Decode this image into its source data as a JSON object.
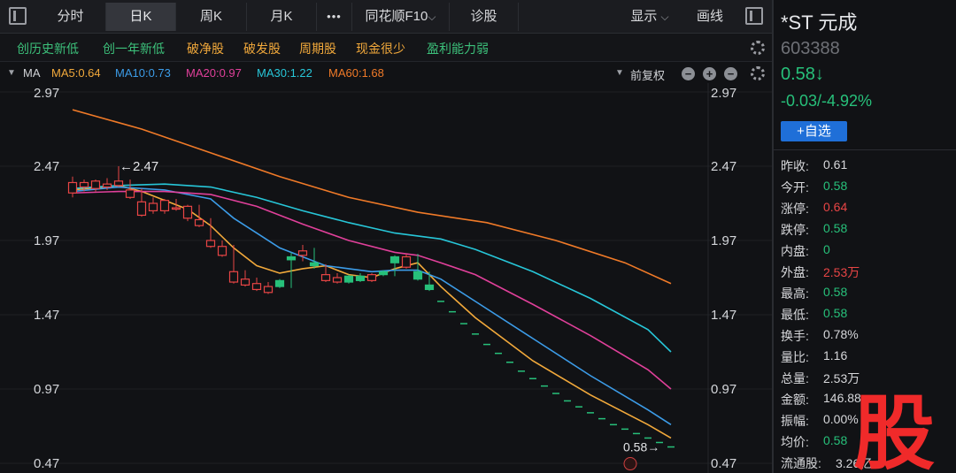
{
  "tabs": {
    "fenshi": "分时",
    "rik": "日K",
    "zhouk": "周K",
    "yuek": "月K",
    "more": "•••",
    "f10": "同花顺F10",
    "zhengu": "诊股",
    "xianshi": "显示",
    "huaxian": "画线"
  },
  "filters": [
    "创历史新低",
    "创一年新低",
    "破净股",
    "破发股",
    "周期股",
    "现金很少",
    "盈利能力弱"
  ],
  "ma": {
    "label": "MA",
    "ma5": "MA5:0.64",
    "ma10": "MA10:0.73",
    "ma20": "MA20:0.97",
    "ma30": "MA30:1.22",
    "ma60": "MA60:1.68",
    "adjust": "前复权"
  },
  "colors": {
    "up": "#e84545",
    "down": "#27c07a",
    "ma5": "#f2a93b",
    "ma10": "#3c9ce8",
    "ma20": "#e0409a",
    "ma30": "#27c6d8",
    "ma60": "#f07a28",
    "filterGreen": "#3cc07a",
    "filterOrange": "#f2a93b"
  },
  "chart_data": {
    "type": "candlestick",
    "ylim": [
      0.47,
      2.97
    ],
    "yticks": [
      "2.97",
      "2.47",
      "1.97",
      "1.47",
      "0.97",
      "0.47"
    ],
    "high_label": "←2.47",
    "low_label": "0.58→",
    "candles": [
      [
        2.33,
        2.36,
        2.29,
        2.4,
        2.26
      ],
      [
        2.36,
        2.36,
        2.33,
        2.38,
        2.3
      ],
      [
        2.33,
        2.37,
        2.32,
        2.38,
        2.3
      ],
      [
        2.37,
        2.35,
        2.33,
        2.39,
        2.31
      ],
      [
        2.35,
        2.37,
        2.34,
        2.47,
        2.33
      ],
      [
        2.37,
        2.31,
        2.26,
        2.38,
        2.25
      ],
      [
        2.31,
        2.23,
        2.14,
        2.32,
        2.13
      ],
      [
        2.23,
        2.22,
        2.17,
        2.26,
        2.15
      ],
      [
        2.22,
        2.24,
        2.17,
        2.25,
        2.15
      ],
      [
        2.24,
        2.19,
        2.19,
        2.25,
        2.17
      ],
      [
        2.19,
        2.2,
        2.12,
        2.21,
        2.1
      ],
      [
        2.2,
        2.11,
        2.07,
        2.21,
        2.06
      ],
      [
        2.11,
        1.97,
        1.93,
        2.12,
        1.92
      ],
      [
        1.97,
        1.93,
        1.87,
        1.97,
        1.86
      ],
      [
        1.93,
        1.76,
        1.69,
        1.94,
        1.68
      ],
      [
        1.76,
        1.71,
        1.67,
        1.77,
        1.66
      ],
      [
        1.71,
        1.68,
        1.64,
        1.72,
        1.63
      ],
      [
        1.68,
        1.66,
        1.62,
        1.69,
        1.61
      ],
      [
        1.66,
        1.66,
        1.7,
        1.71,
        1.65
      ],
      [
        1.66,
        1.84,
        1.86,
        1.89,
        1.65
      ],
      [
        1.84,
        1.9,
        1.87,
        1.94,
        1.83
      ],
      [
        1.9,
        1.8,
        1.82,
        1.92,
        1.78
      ],
      [
        1.8,
        1.74,
        1.7,
        1.81,
        1.69
      ],
      [
        1.74,
        1.72,
        1.69,
        1.75,
        1.68
      ],
      [
        1.72,
        1.69,
        1.73,
        1.74,
        1.68
      ],
      [
        1.69,
        1.7,
        1.73,
        1.75,
        1.69
      ],
      [
        1.7,
        1.74,
        1.7,
        1.75,
        1.69
      ],
      [
        1.74,
        1.74,
        1.76,
        1.77,
        1.73
      ],
      [
        1.74,
        1.82,
        1.86,
        1.87,
        1.73
      ],
      [
        1.82,
        1.86,
        1.79,
        1.88,
        1.78
      ],
      [
        1.86,
        1.71,
        1.76,
        1.88,
        1.7
      ],
      [
        1.71,
        1.64,
        1.67,
        1.76,
        1.63
      ],
      [
        1.64,
        1.56,
        1.56,
        1.56,
        1.56
      ],
      [
        1.56,
        1.49,
        1.49,
        1.49,
        1.49
      ],
      [
        1.49,
        1.41,
        1.41,
        1.41,
        1.41
      ],
      [
        1.41,
        1.34,
        1.34,
        1.34,
        1.34
      ],
      [
        1.34,
        1.27,
        1.27,
        1.27,
        1.27
      ],
      [
        1.27,
        1.21,
        1.21,
        1.21,
        1.21
      ],
      [
        1.21,
        1.15,
        1.15,
        1.15,
        1.15
      ],
      [
        1.15,
        1.09,
        1.09,
        1.09,
        1.09
      ],
      [
        1.09,
        1.04,
        1.04,
        1.04,
        1.04
      ],
      [
        1.04,
        0.99,
        0.99,
        0.99,
        0.99
      ],
      [
        0.99,
        0.94,
        0.94,
        0.94,
        0.94
      ],
      [
        0.94,
        0.89,
        0.89,
        0.89,
        0.89
      ],
      [
        0.89,
        0.85,
        0.85,
        0.85,
        0.85
      ],
      [
        0.85,
        0.81,
        0.81,
        0.81,
        0.81
      ],
      [
        0.81,
        0.77,
        0.77,
        0.77,
        0.77
      ],
      [
        0.77,
        0.73,
        0.73,
        0.73,
        0.73
      ],
      [
        0.73,
        0.7,
        0.7,
        0.7,
        0.7
      ],
      [
        0.7,
        0.67,
        0.67,
        0.67,
        0.67
      ],
      [
        0.67,
        0.64,
        0.64,
        0.64,
        0.64
      ],
      [
        0.64,
        0.61,
        0.61,
        0.61,
        0.61
      ],
      [
        0.61,
        0.58,
        0.58,
        0.58,
        0.58
      ]
    ],
    "candle_fields": [
      "prev_close",
      "close",
      "open",
      "high",
      "low"
    ],
    "series": [
      {
        "name": "MA5",
        "color": "#f2a93b",
        "values": [
          [
            0,
            2.31
          ],
          [
            4,
            2.34
          ],
          [
            6,
            2.3
          ],
          [
            8,
            2.24
          ],
          [
            10,
            2.18
          ],
          [
            12,
            2.07
          ],
          [
            14,
            1.92
          ],
          [
            16,
            1.8
          ],
          [
            18,
            1.75
          ],
          [
            20,
            1.78
          ],
          [
            22,
            1.8
          ],
          [
            24,
            1.74
          ],
          [
            26,
            1.72
          ],
          [
            28,
            1.78
          ],
          [
            30,
            1.82
          ],
          [
            32,
            1.66
          ],
          [
            35,
            1.45
          ],
          [
            40,
            1.16
          ],
          [
            45,
            0.93
          ],
          [
            50,
            0.73
          ],
          [
            52,
            0.64
          ]
        ]
      },
      {
        "name": "MA10",
        "color": "#3c9ce8",
        "values": [
          [
            0,
            2.3
          ],
          [
            4,
            2.33
          ],
          [
            8,
            2.31
          ],
          [
            12,
            2.25
          ],
          [
            14,
            2.12
          ],
          [
            16,
            2.02
          ],
          [
            18,
            1.92
          ],
          [
            20,
            1.86
          ],
          [
            22,
            1.8
          ],
          [
            24,
            1.78
          ],
          [
            26,
            1.76
          ],
          [
            28,
            1.77
          ],
          [
            30,
            1.77
          ],
          [
            32,
            1.71
          ],
          [
            35,
            1.56
          ],
          [
            40,
            1.31
          ],
          [
            45,
            1.06
          ],
          [
            50,
            0.83
          ],
          [
            52,
            0.73
          ]
        ]
      },
      {
        "name": "MA20",
        "color": "#e0409a",
        "values": [
          [
            0,
            2.29
          ],
          [
            4,
            2.3
          ],
          [
            8,
            2.3
          ],
          [
            12,
            2.28
          ],
          [
            16,
            2.2
          ],
          [
            20,
            2.08
          ],
          [
            24,
            1.97
          ],
          [
            28,
            1.89
          ],
          [
            30,
            1.87
          ],
          [
            32,
            1.82
          ],
          [
            35,
            1.74
          ],
          [
            40,
            1.54
          ],
          [
            45,
            1.33
          ],
          [
            50,
            1.1
          ],
          [
            52,
            0.97
          ]
        ]
      },
      {
        "name": "MA30",
        "color": "#27c6d8",
        "values": [
          [
            0,
            2.32
          ],
          [
            4,
            2.34
          ],
          [
            8,
            2.35
          ],
          [
            12,
            2.33
          ],
          [
            16,
            2.26
          ],
          [
            20,
            2.17
          ],
          [
            24,
            2.09
          ],
          [
            28,
            2.02
          ],
          [
            32,
            1.98
          ],
          [
            35,
            1.91
          ],
          [
            40,
            1.76
          ],
          [
            45,
            1.58
          ],
          [
            50,
            1.37
          ],
          [
            52,
            1.22
          ]
        ]
      },
      {
        "name": "MA60",
        "color": "#f07a28",
        "values": [
          [
            0,
            2.85
          ],
          [
            6,
            2.72
          ],
          [
            12,
            2.56
          ],
          [
            18,
            2.4
          ],
          [
            24,
            2.26
          ],
          [
            30,
            2.16
          ],
          [
            36,
            2.09
          ],
          [
            42,
            1.97
          ],
          [
            48,
            1.82
          ],
          [
            52,
            1.68
          ]
        ]
      }
    ]
  },
  "right": {
    "name": "*ST 元成",
    "code": "603388",
    "price": "0.58↓",
    "change": "-0.03/-4.92%",
    "add_button": "+自选",
    "quotes": [
      {
        "k": "昨收:",
        "v": "0.61",
        "c": "#d6d7da"
      },
      {
        "k": "今开:",
        "v": "0.58",
        "c": "#27c07a"
      },
      {
        "k": "涨停:",
        "v": "0.64",
        "c": "#e84545"
      },
      {
        "k": "跌停:",
        "v": "0.58",
        "c": "#27c07a"
      },
      {
        "k": "内盘:",
        "v": "0",
        "c": "#27c07a"
      },
      {
        "k": "外盘:",
        "v": "2.53万",
        "c": "#e84545"
      },
      {
        "k": "最高:",
        "v": "0.58",
        "c": "#27c07a"
      },
      {
        "k": "最低:",
        "v": "0.58",
        "c": "#27c07a"
      },
      {
        "k": "换手:",
        "v": "0.78%",
        "c": "#d6d7da"
      },
      {
        "k": "量比:",
        "v": "1.16",
        "c": "#d6d7da"
      },
      {
        "k": "总量:",
        "v": "2.53万",
        "c": "#d6d7da"
      },
      {
        "k": "金额:",
        "v": "146.88",
        "c": "#d6d7da"
      },
      {
        "k": "振幅:",
        "v": "0.00%",
        "c": "#d6d7da"
      },
      {
        "k": "均价:",
        "v": "0.58",
        "c": "#27c07a"
      },
      {
        "k": "流通股:",
        "v": "3.26亿",
        "c": "#d6d7da"
      }
    ],
    "watermark": "股"
  }
}
